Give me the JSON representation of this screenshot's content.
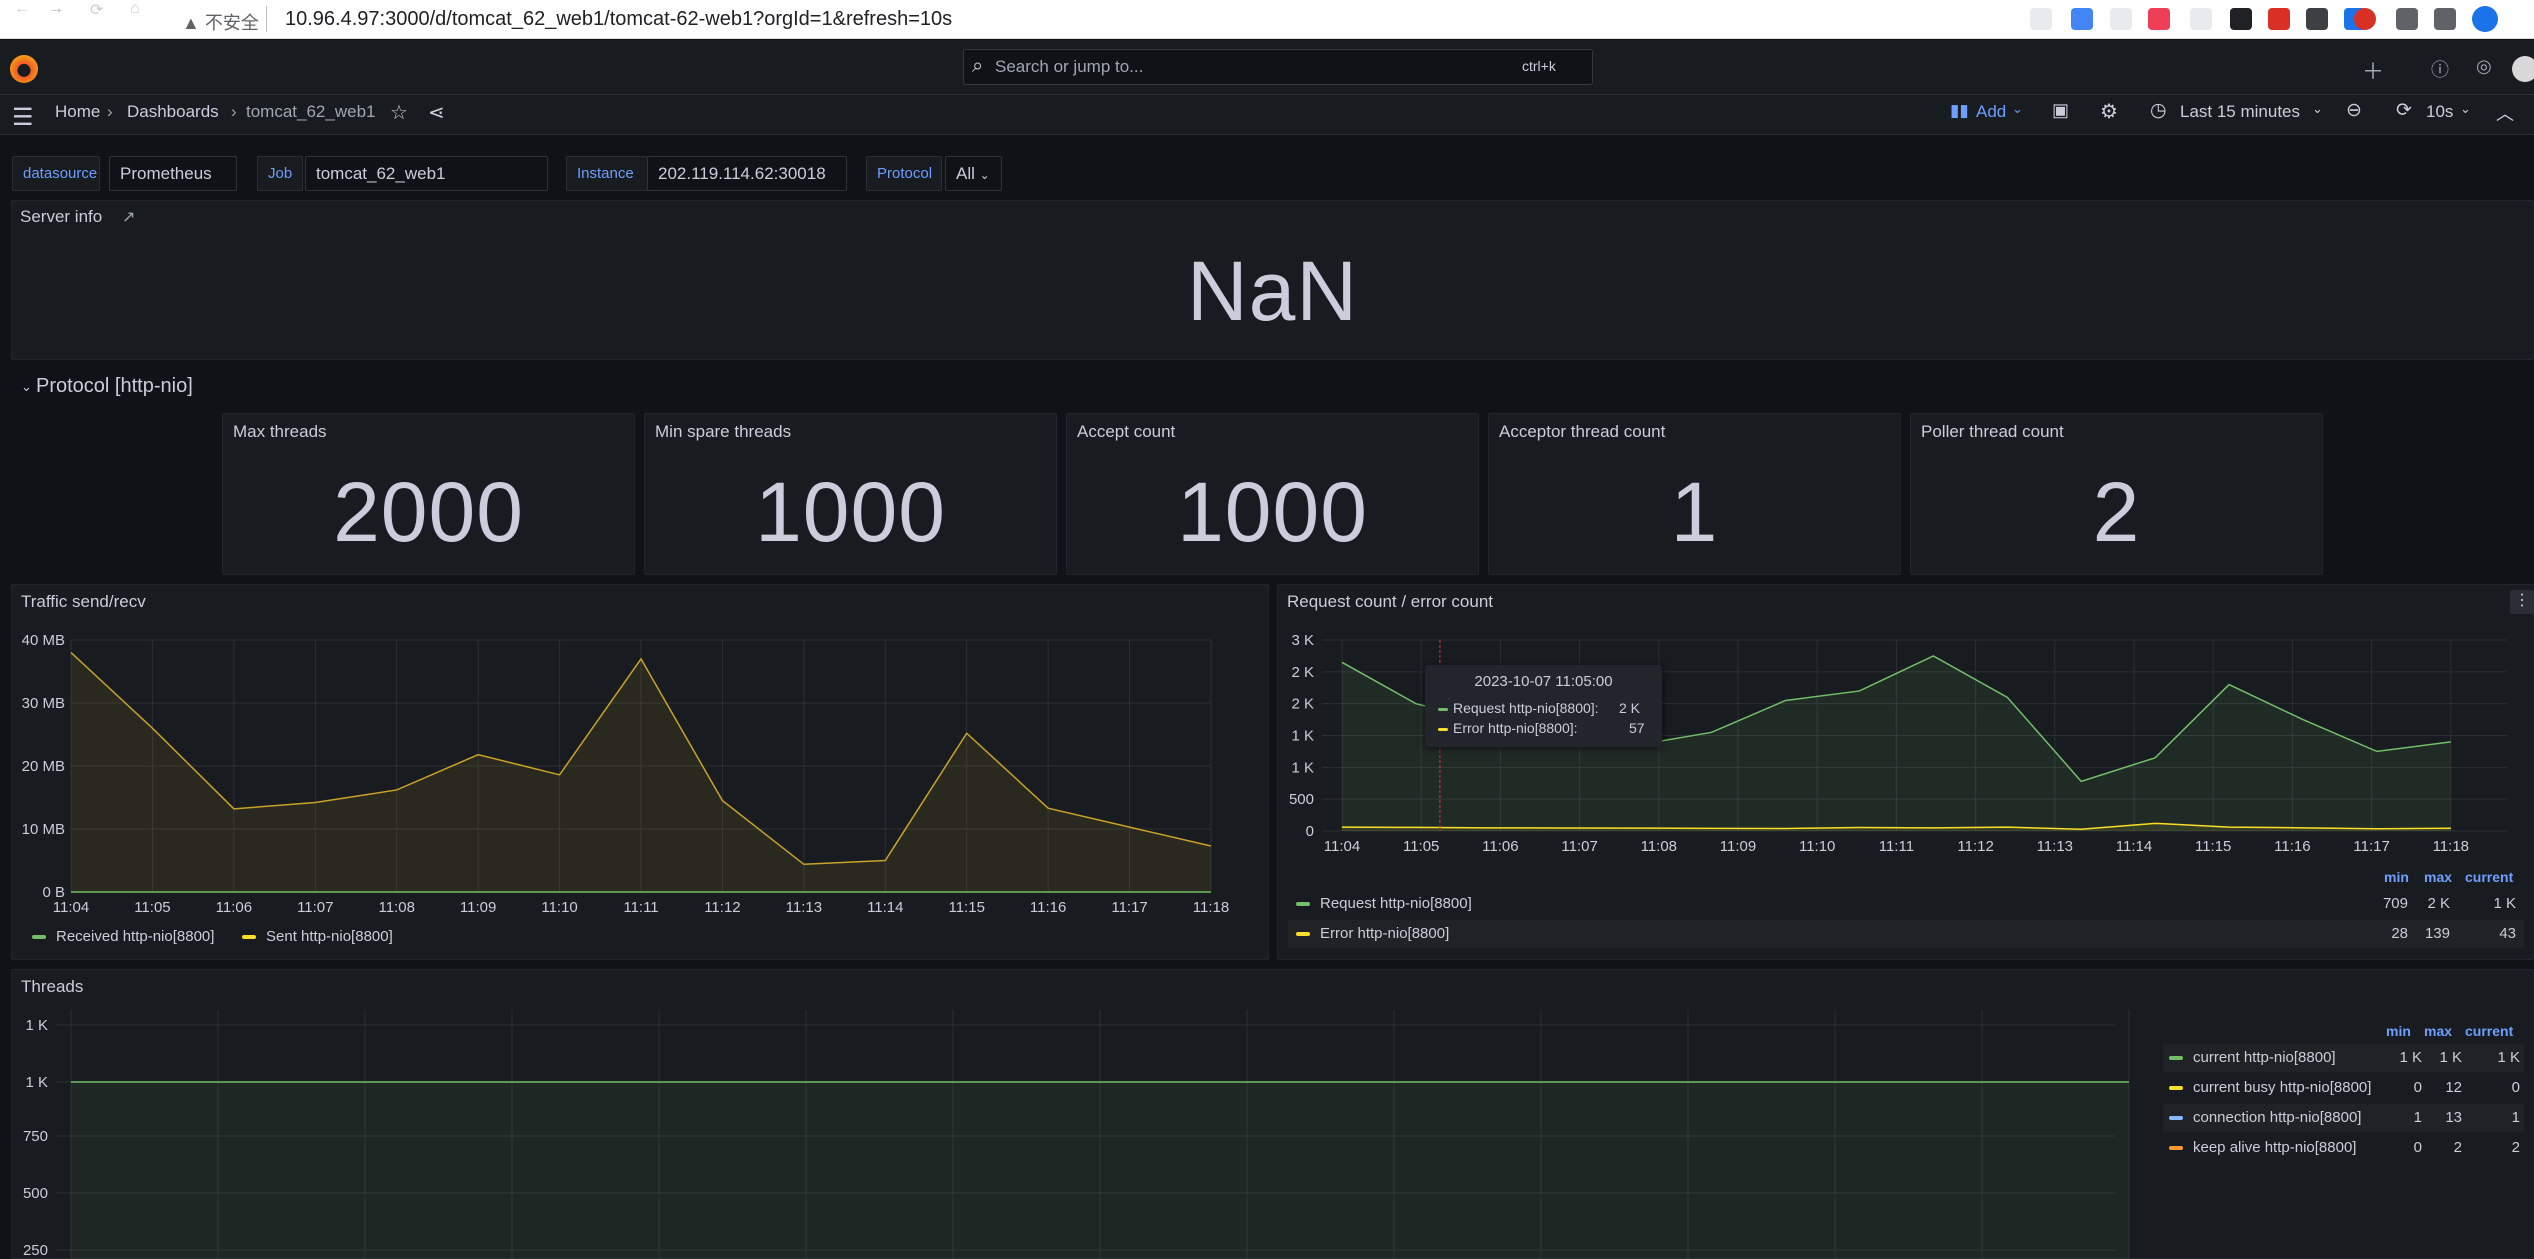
{
  "browser": {
    "nav": {
      "back": "←",
      "forward": "→",
      "reload": "⟳",
      "home": "⌂"
    },
    "security_label": "▲ 不安全",
    "url": "10.96.4.97:3000/d/tomcat_62_web1/tomcat-62-web1?orgId=1&refresh=10s"
  },
  "topbar": {
    "search_placeholder": "Search or jump to...",
    "search_shortcut": "ctrl+k"
  },
  "breadcrumb": {
    "home": "Home",
    "sep1": "›",
    "dashboards": "Dashboards",
    "sep2": "›",
    "current": "tomcat_62_web1"
  },
  "toolbar": {
    "add_label": "Add",
    "time_range": "Last 15 minutes",
    "refresh_interval": "10s"
  },
  "variables": {
    "datasource_label": "datasource",
    "datasource_value": "Prometheus",
    "job_label": "Job",
    "job_value": "tomcat_62_web1",
    "instance_label": "Instance",
    "instance_value": "202.119.114.62:30018",
    "protocol_label": "Protocol",
    "protocol_value": "All"
  },
  "server_info": {
    "title": "Server info",
    "value": "NaN"
  },
  "row_title": "Protocol [http-nio]",
  "stats": [
    {
      "title": "Max threads",
      "value": "2000"
    },
    {
      "title": "Min spare threads",
      "value": "1000"
    },
    {
      "title": "Accept count",
      "value": "1000"
    },
    {
      "title": "Acceptor thread count",
      "value": "1"
    },
    {
      "title": "Poller thread count",
      "value": "2"
    }
  ],
  "colors": {
    "green": "#73bf69",
    "yellow": "#fade2a",
    "blue": "#8ab8ff",
    "orange": "#ff9830",
    "accent": "#6e9fff",
    "traffic_line": "#c9a227"
  },
  "chart_data": [
    {
      "type": "area",
      "title": "Traffic send/recv",
      "x": [
        "11:04",
        "11:05",
        "11:06",
        "11:07",
        "11:08",
        "11:09",
        "11:10",
        "11:11",
        "11:12",
        "11:13",
        "11:14",
        "11:15",
        "11:16",
        "11:17",
        "11:18"
      ],
      "yticks": [
        "0 B",
        "10 MB",
        "20 MB",
        "30 MB",
        "40 MB"
      ],
      "ylim": [
        0,
        40
      ],
      "series": [
        {
          "name": "Received http-nio[8800]",
          "color": "#73bf69",
          "values": [
            0,
            0,
            0,
            0,
            0,
            0,
            0,
            0,
            0,
            0,
            0,
            0,
            0,
            0,
            0
          ]
        },
        {
          "name": "Sent http-nio[8800]",
          "color": "#c9a227",
          "values": [
            38,
            26,
            13.2,
            14.2,
            16.2,
            21.8,
            18.6,
            37,
            14.5,
            4.4,
            5,
            25.2,
            13.3,
            10.3,
            7.3
          ]
        }
      ],
      "legend": "bottom"
    },
    {
      "type": "area",
      "title": "Request count / error count",
      "x": [
        "11:04",
        "11:05",
        "11:06",
        "11:07",
        "11:08",
        "11:09",
        "11:10",
        "11:11",
        "11:12",
        "11:13",
        "11:14",
        "11:15",
        "11:16",
        "11:17",
        "11:18"
      ],
      "yticks": [
        "0",
        "500",
        "1 K",
        "1 K",
        "2 K",
        "2 K",
        "3 K"
      ],
      "ylim": [
        0,
        3000
      ],
      "series": [
        {
          "name": "Request http-nio[8800]",
          "color": "#73bf69",
          "values": [
            2650,
            2000,
            1720,
            1780,
            1350,
            1550,
            2050,
            2200,
            2750,
            2100,
            780,
            1150,
            2300,
            1750,
            1250,
            1400
          ],
          "min": "709",
          "max": "2 K",
          "current": "1 K"
        },
        {
          "name": "Error http-nio[8800]",
          "color": "#fade2a",
          "values": [
            60,
            57,
            50,
            48,
            45,
            42,
            40,
            55,
            50,
            60,
            28,
            120,
            60,
            50,
            35,
            43
          ],
          "min": "28",
          "max": "139",
          "current": "43"
        }
      ],
      "legend_headers": [
        "min",
        "max",
        "current"
      ],
      "tooltip": {
        "time": "2023-10-07 11:05:00",
        "rows": [
          {
            "name": "Request http-nio[8800]:",
            "value": "2 K"
          },
          {
            "name": "Error http-nio[8800]:",
            "value": "57"
          }
        ]
      }
    },
    {
      "type": "area",
      "title": "Threads",
      "yticks": [
        "250",
        "500",
        "750",
        "1 K",
        "1 K"
      ],
      "series": [
        {
          "name": "current http-nio[8800]",
          "color": "#73bf69",
          "min": "1 K",
          "max": "1 K",
          "current": "1 K"
        },
        {
          "name": "current busy http-nio[8800]",
          "color": "#fade2a",
          "min": "0",
          "max": "12",
          "current": "0"
        },
        {
          "name": "connection http-nio[8800]",
          "color": "#8ab8ff",
          "min": "1",
          "max": "13",
          "current": "1"
        },
        {
          "name": "keep alive http-nio[8800]",
          "color": "#ff9830",
          "min": "0",
          "max": "2",
          "current": "2"
        }
      ],
      "legend_headers": [
        "min",
        "max",
        "current"
      ]
    }
  ]
}
